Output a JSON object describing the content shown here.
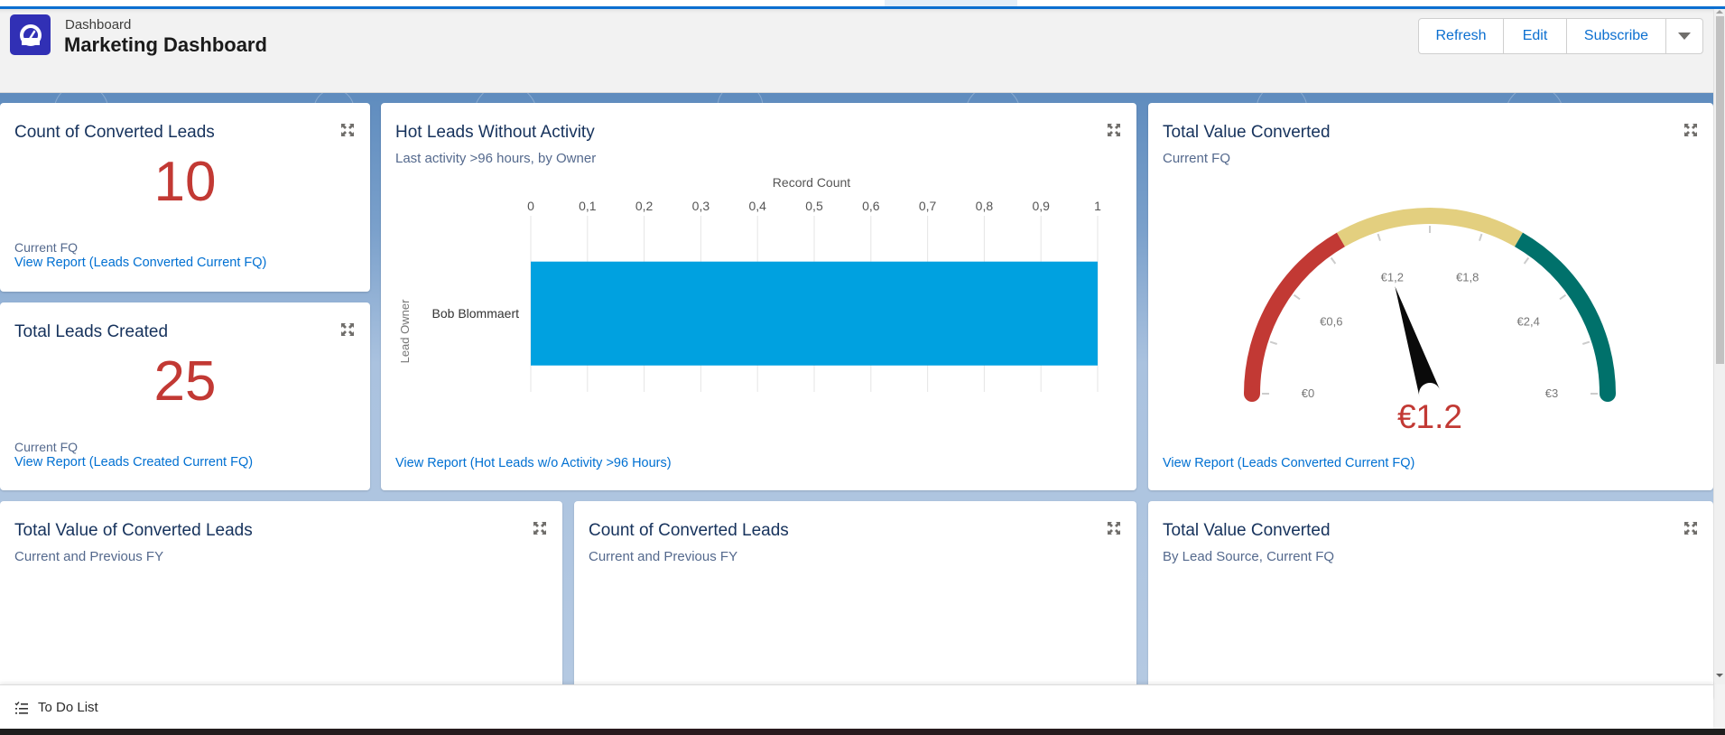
{
  "header": {
    "breadcrumb": "Dashboard",
    "title": "Marketing Dashboard",
    "logo_icon": "dashboard-gauge-icon",
    "buttons": [
      {
        "label": "Refresh"
      },
      {
        "label": "Edit"
      },
      {
        "label": "Subscribe"
      },
      {
        "label": "",
        "icon": "caret-down-icon"
      }
    ]
  },
  "colors": {
    "accent": "#0b6fd0",
    "metric": "#c23934",
    "link": "#0070d2",
    "bar": "#00a1e0",
    "gauge_red": "#c23934",
    "gauge_yellow": "#e3cf7f",
    "gauge_teal": "#00716b"
  },
  "cards": {
    "converted_count": {
      "title": "Count of Converted Leads",
      "value": "10",
      "footer": "Current FQ",
      "link": "View Report (Leads Converted Current FQ)"
    },
    "leads_created": {
      "title": "Total Leads Created",
      "value": "25",
      "footer": "Current FQ",
      "link": "View Report (Leads Created Current FQ)"
    },
    "hot_leads": {
      "title": "Hot Leads Without Activity",
      "subtitle": "Last activity >96 hours, by Owner",
      "link": "View Report (Hot Leads w/o Activity >96 Hours)"
    },
    "gauge": {
      "title": "Total Value Converted",
      "subtitle": "Current FQ",
      "value_label": "€1.2",
      "link": "View Report (Leads Converted Current FQ)"
    },
    "value_converted_fy": {
      "title": "Total Value of Converted Leads",
      "subtitle": "Current and Previous FY"
    },
    "count_converted_fy": {
      "title": "Count of Converted Leads",
      "subtitle": "Current and Previous FY"
    },
    "value_by_source": {
      "title": "Total Value Converted",
      "subtitle": "By Lead Source, Current FQ"
    }
  },
  "chart_data": [
    {
      "type": "bar",
      "orientation": "horizontal",
      "title": "Hot Leads Without Activity",
      "xlabel": "Record Count",
      "ylabel": "Lead Owner",
      "categories": [
        "Bob Blommaert"
      ],
      "values": [
        1
      ],
      "xlim": [
        0,
        1
      ],
      "ticks": [
        "0",
        "0,1",
        "0,2",
        "0,3",
        "0,4",
        "0,5",
        "0,6",
        "0,7",
        "0,8",
        "0,9",
        "1"
      ],
      "grid": true
    },
    {
      "type": "gauge",
      "title": "Total Value Converted",
      "value": 1.2,
      "value_label": "€1.2",
      "range": [
        0,
        3
      ],
      "bands": [
        {
          "from": 0,
          "to": 1,
          "color": "#c23934"
        },
        {
          "from": 1,
          "to": 2,
          "color": "#e3cf7f"
        },
        {
          "from": 2,
          "to": 3,
          "color": "#00716b"
        }
      ],
      "minor_tick_step": 0.3,
      "labels": [
        {
          "value": 0,
          "text": "€0"
        },
        {
          "value": 0.6,
          "text": "€0,6"
        },
        {
          "value": 1.2,
          "text": "€1,2"
        },
        {
          "value": 1.8,
          "text": "€1,8"
        },
        {
          "value": 2.4,
          "text": "€2,4"
        },
        {
          "value": 3,
          "text": "€3"
        }
      ]
    }
  ],
  "utility_bar": {
    "todo_label": "To Do List"
  }
}
